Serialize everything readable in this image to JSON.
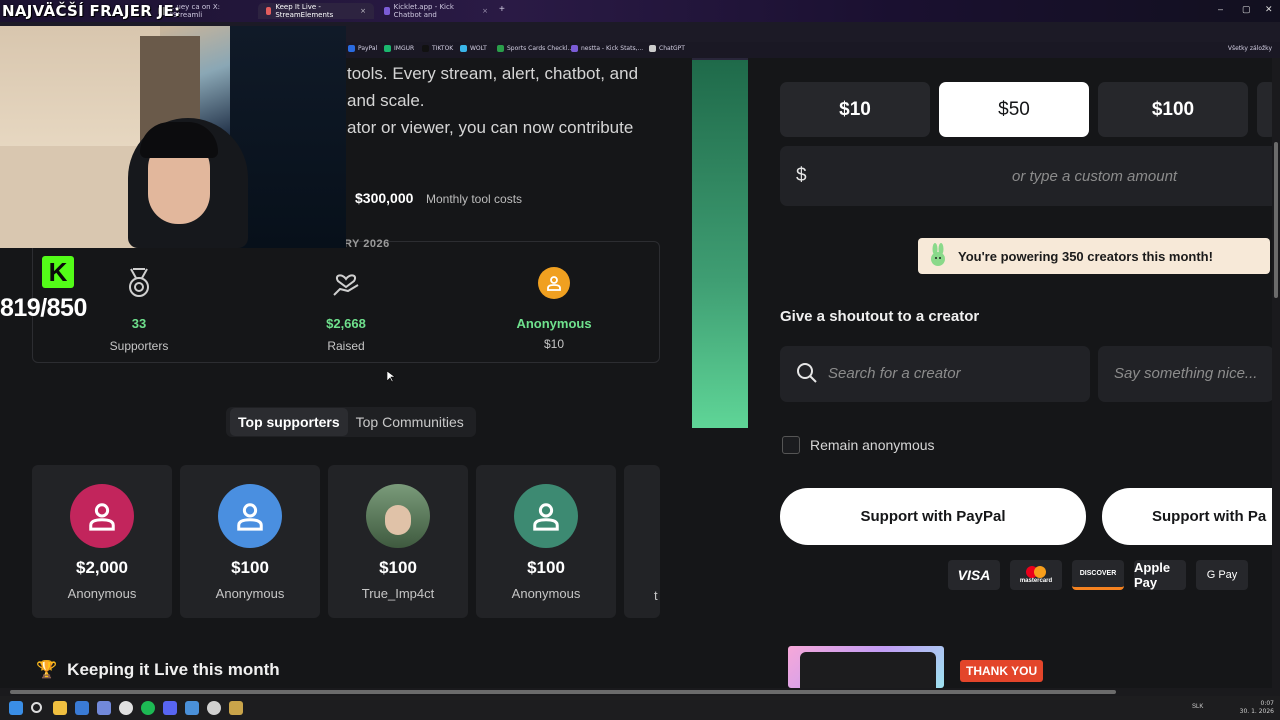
{
  "browser": {
    "tabs": [
      {
        "label": "...uey ca on X: \"Streamli",
        "active": false
      },
      {
        "label": "Keep It Live - StreamElements",
        "active": true
      },
      {
        "label": "Kicklet.app - Kick Chatbot and",
        "active": false
      }
    ],
    "new_tab": "+",
    "bookmarks": [
      "PayPal",
      "IMGUR",
      "TIKTOK",
      "WOLT",
      "Sports Cards Checkl...",
      "nestta - Kick Stats,...",
      "ChatGPT"
    ],
    "all_bookmarks": "Všetky záložky"
  },
  "overlay": {
    "title": "NAJVÄČŠÍ FRAJER JE:",
    "counter": "819/850",
    "kick_letter": "K"
  },
  "intro": {
    "line1": "tools. Every stream, alert, chatbot, and",
    "line2": "and scale.",
    "line3": "ator or viewer, you can now contribute"
  },
  "cost": {
    "value": "$300,000",
    "label": "Monthly tool costs"
  },
  "month_heading": "RY 2026",
  "stats": {
    "supporters": {
      "value": "33",
      "label": "Supporters"
    },
    "raised": {
      "value": "$2,668",
      "label": "Raised"
    },
    "latest": {
      "value": "Anonymous",
      "label": "$10"
    }
  },
  "toggle": {
    "top_supporters": "Top supporters",
    "top_communities": "Top Communities"
  },
  "supporters": [
    {
      "amount": "$2,000",
      "name": "Anonymous",
      "color": "#c2255c"
    },
    {
      "amount": "$100",
      "name": "Anonymous",
      "color": "#4a8fe0"
    },
    {
      "amount": "$100",
      "name": "True_Imp4ct",
      "color": "#6a9a6a"
    },
    {
      "amount": "$100",
      "name": "Anonymous",
      "color": "#3d8a72"
    },
    {
      "amount": "",
      "name": "t",
      "color": "#222326"
    }
  ],
  "keeping_heading": "Keeping it Live this month",
  "amounts": [
    "$10",
    "$50",
    "$100"
  ],
  "custom_amount": {
    "currency": "$",
    "placeholder": "or type a custom amount"
  },
  "powering": "You're powering 350 creators this month!",
  "shoutout": {
    "heading": "Give a shoutout to a creator",
    "search_placeholder": "Search for a creator",
    "message_placeholder": "Say something nice..."
  },
  "anonymous_label": "Remain anonymous",
  "paypal_buttons": [
    "Support with PayPal",
    "Support with Pa"
  ],
  "payment_methods": [
    "VISA",
    "mastercard",
    "DISCOVER",
    "Apple Pay",
    "G Pay"
  ],
  "thank_you": "THANK YOU",
  "taskbar": {
    "lang": "SLK",
    "time": "0:07",
    "date": "30. 1. 2026"
  },
  "colors": {
    "accent_green": "#6fe18d",
    "kick_green": "#53fc18",
    "thanks_red": "#e3452a"
  }
}
